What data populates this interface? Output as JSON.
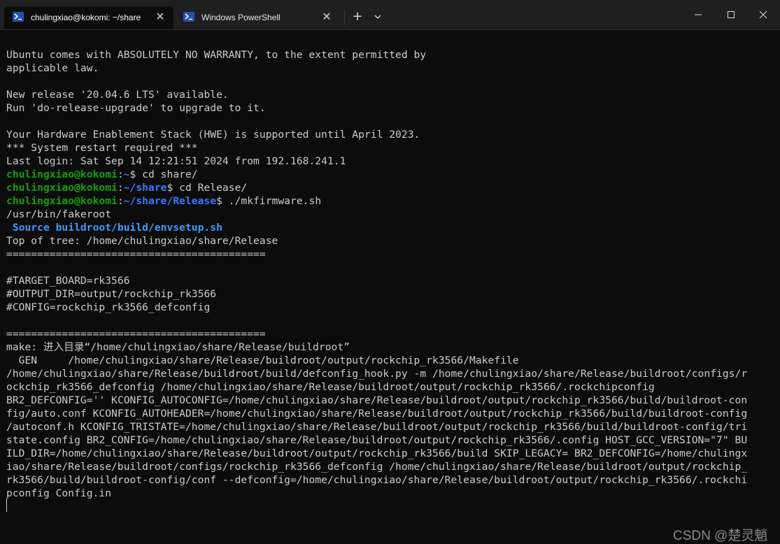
{
  "window": {
    "tabs": [
      {
        "label": "chulingxiao@kokomi: ~/share",
        "icon": "terminal-icon",
        "active": true
      },
      {
        "label": "Windows PowerShell",
        "icon": "powershell-icon",
        "active": false
      }
    ],
    "new_tab_label": "+",
    "controls": [
      "minimize",
      "maximize",
      "close"
    ]
  },
  "terminal": {
    "lines": [
      {
        "segments": [
          {
            "text": "Ubuntu comes with ABSOLUTELY NO WARRANTY, to the extent permitted by",
            "style": ""
          }
        ]
      },
      {
        "segments": [
          {
            "text": "applicable law.",
            "style": ""
          }
        ]
      },
      {
        "segments": [
          {
            "text": " ",
            "style": ""
          }
        ]
      },
      {
        "segments": [
          {
            "text": "New release '20.04.6 LTS' available.",
            "style": ""
          }
        ]
      },
      {
        "segments": [
          {
            "text": "Run 'do-release-upgrade' to upgrade to it.",
            "style": ""
          }
        ]
      },
      {
        "segments": [
          {
            "text": " ",
            "style": ""
          }
        ]
      },
      {
        "segments": [
          {
            "text": "Your Hardware Enablement Stack (HWE) is supported until April 2023.",
            "style": ""
          }
        ]
      },
      {
        "segments": [
          {
            "text": "*** System restart required ***",
            "style": ""
          }
        ]
      },
      {
        "segments": [
          {
            "text": "Last login: Sat Sep 14 12:21:51 2024 from 192.168.241.1",
            "style": ""
          }
        ]
      },
      {
        "segments": [
          {
            "text": "chulingxiao@kokomi",
            "style": "g"
          },
          {
            "text": ":",
            "style": ""
          },
          {
            "text": "~",
            "style": "b"
          },
          {
            "text": "$ cd share/",
            "style": ""
          }
        ]
      },
      {
        "segments": [
          {
            "text": "chulingxiao@kokomi",
            "style": "g"
          },
          {
            "text": ":",
            "style": ""
          },
          {
            "text": "~/share",
            "style": "b"
          },
          {
            "text": "$ cd Release/",
            "style": ""
          }
        ]
      },
      {
        "segments": [
          {
            "text": "chulingxiao@kokomi",
            "style": "g"
          },
          {
            "text": ":",
            "style": ""
          },
          {
            "text": "~/share/Release",
            "style": "b"
          },
          {
            "text": "$ ./mkfirmware.sh",
            "style": ""
          }
        ]
      },
      {
        "segments": [
          {
            "text": "/usr/bin/fakeroot",
            "style": ""
          }
        ]
      },
      {
        "segments": [
          {
            "text": " Source buildroot/build/envsetup.sh",
            "style": "lb"
          }
        ]
      },
      {
        "segments": [
          {
            "text": "Top of tree: /home/chulingxiao/share/Release",
            "style": ""
          }
        ]
      },
      {
        "segments": [
          {
            "text": "==========================================",
            "style": ""
          }
        ]
      },
      {
        "segments": [
          {
            "text": " ",
            "style": ""
          }
        ]
      },
      {
        "segments": [
          {
            "text": "#TARGET_BOARD=rk3566",
            "style": ""
          }
        ]
      },
      {
        "segments": [
          {
            "text": "#OUTPUT_DIR=output/rockchip_rk3566",
            "style": ""
          }
        ]
      },
      {
        "segments": [
          {
            "text": "#CONFIG=rockchip_rk3566_defconfig",
            "style": ""
          }
        ]
      },
      {
        "segments": [
          {
            "text": " ",
            "style": ""
          }
        ]
      },
      {
        "segments": [
          {
            "text": "==========================================",
            "style": ""
          }
        ]
      },
      {
        "segments": [
          {
            "text": "make: 进入目录“/home/chulingxiao/share/Release/buildroot”",
            "style": ""
          }
        ]
      },
      {
        "segments": [
          {
            "text": "  GEN     /home/chulingxiao/share/Release/buildroot/output/rockchip_rk3566/Makefile",
            "style": ""
          }
        ]
      },
      {
        "segments": [
          {
            "text": "/home/chulingxiao/share/Release/buildroot/build/defconfig_hook.py -m /home/chulingxiao/share/Release/buildroot/configs/r",
            "style": ""
          }
        ]
      },
      {
        "segments": [
          {
            "text": "ockchip_rk3566_defconfig /home/chulingxiao/share/Release/buildroot/output/rockchip_rk3566/.rockchipconfig",
            "style": ""
          }
        ]
      },
      {
        "segments": [
          {
            "text": "BR2_DEFCONFIG='' KCONFIG_AUTOCONFIG=/home/chulingxiao/share/Release/buildroot/output/rockchip_rk3566/build/buildroot-con",
            "style": ""
          }
        ]
      },
      {
        "segments": [
          {
            "text": "fig/auto.conf KCONFIG_AUTOHEADER=/home/chulingxiao/share/Release/buildroot/output/rockchip_rk3566/build/buildroot-config",
            "style": ""
          }
        ]
      },
      {
        "segments": [
          {
            "text": "/autoconf.h KCONFIG_TRISTATE=/home/chulingxiao/share/Release/buildroot/output/rockchip_rk3566/build/buildroot-config/tri",
            "style": ""
          }
        ]
      },
      {
        "segments": [
          {
            "text": "state.config BR2_CONFIG=/home/chulingxiao/share/Release/buildroot/output/rockchip_rk3566/.config HOST_GCC_VERSION=\"7\" BU",
            "style": ""
          }
        ]
      },
      {
        "segments": [
          {
            "text": "ILD_DIR=/home/chulingxiao/share/Release/buildroot/output/rockchip_rk3566/build SKIP_LEGACY= BR2_DEFCONFIG=/home/chulingx",
            "style": ""
          }
        ]
      },
      {
        "segments": [
          {
            "text": "iao/share/Release/buildroot/configs/rockchip_rk3566_defconfig /home/chulingxiao/share/Release/buildroot/output/rockchip_",
            "style": ""
          }
        ]
      },
      {
        "segments": [
          {
            "text": "rk3566/build/buildroot-config/conf --defconfig=/home/chulingxiao/share/Release/buildroot/output/rockchip_rk3566/.rockchi",
            "style": ""
          }
        ]
      },
      {
        "segments": [
          {
            "text": "pconfig Config.in",
            "style": ""
          }
        ]
      }
    ]
  },
  "watermark": "CSDN @楚灵魈",
  "colors": {
    "background": "#0c0c0c",
    "text": "#cccccc",
    "prompt_user": "#13a10e",
    "prompt_path": "#3b78ff",
    "info": "#3b9dff"
  }
}
